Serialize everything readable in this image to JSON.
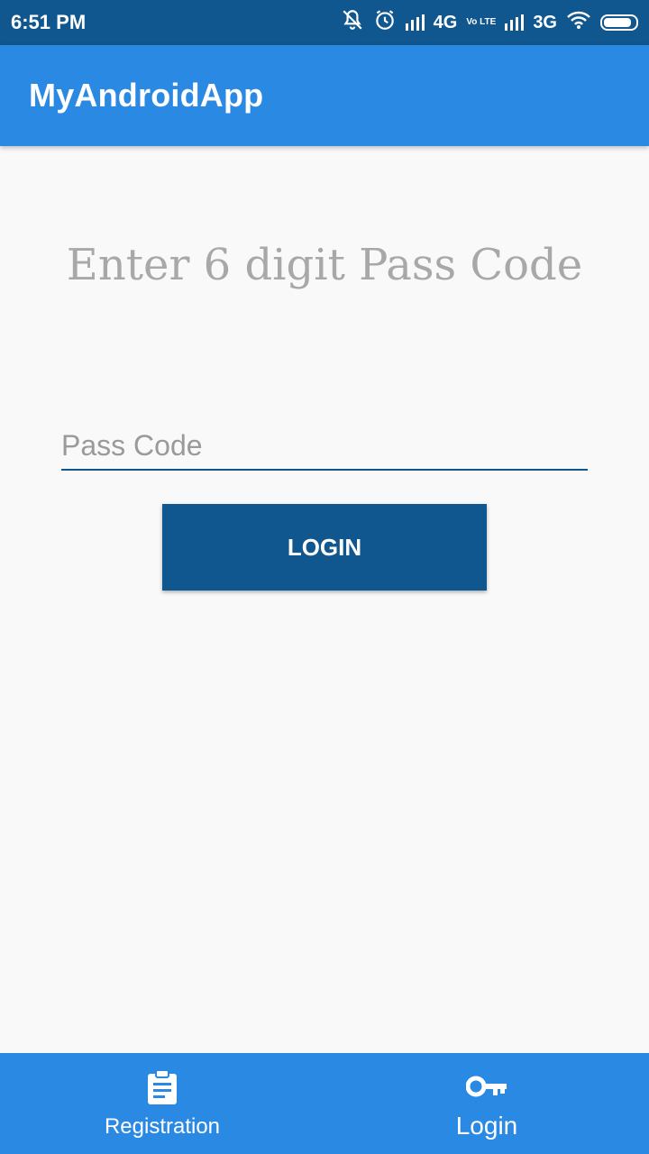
{
  "status_bar": {
    "time": "6:51 PM",
    "network1": "4G",
    "volte": "Vo LTE",
    "network2": "3G",
    "icons": [
      "mute-icon",
      "alarm-icon",
      "signal-icon",
      "wifi-icon",
      "battery-icon"
    ]
  },
  "app_bar": {
    "title": "MyAndroidApp"
  },
  "main": {
    "heading": "Enter 6 digit Pass Code",
    "passcode_placeholder": "Pass Code",
    "passcode_value": "",
    "login_label": "LOGIN"
  },
  "bottom_nav": {
    "items": [
      {
        "label": "Registration",
        "icon": "clipboard-icon"
      },
      {
        "label": "Login",
        "icon": "key-icon"
      }
    ]
  },
  "colors": {
    "status_bar": "#10568f",
    "app_bar": "#2989e3",
    "button": "#10568f",
    "heading": "#a8a8a8",
    "background": "#f9f9f9"
  }
}
